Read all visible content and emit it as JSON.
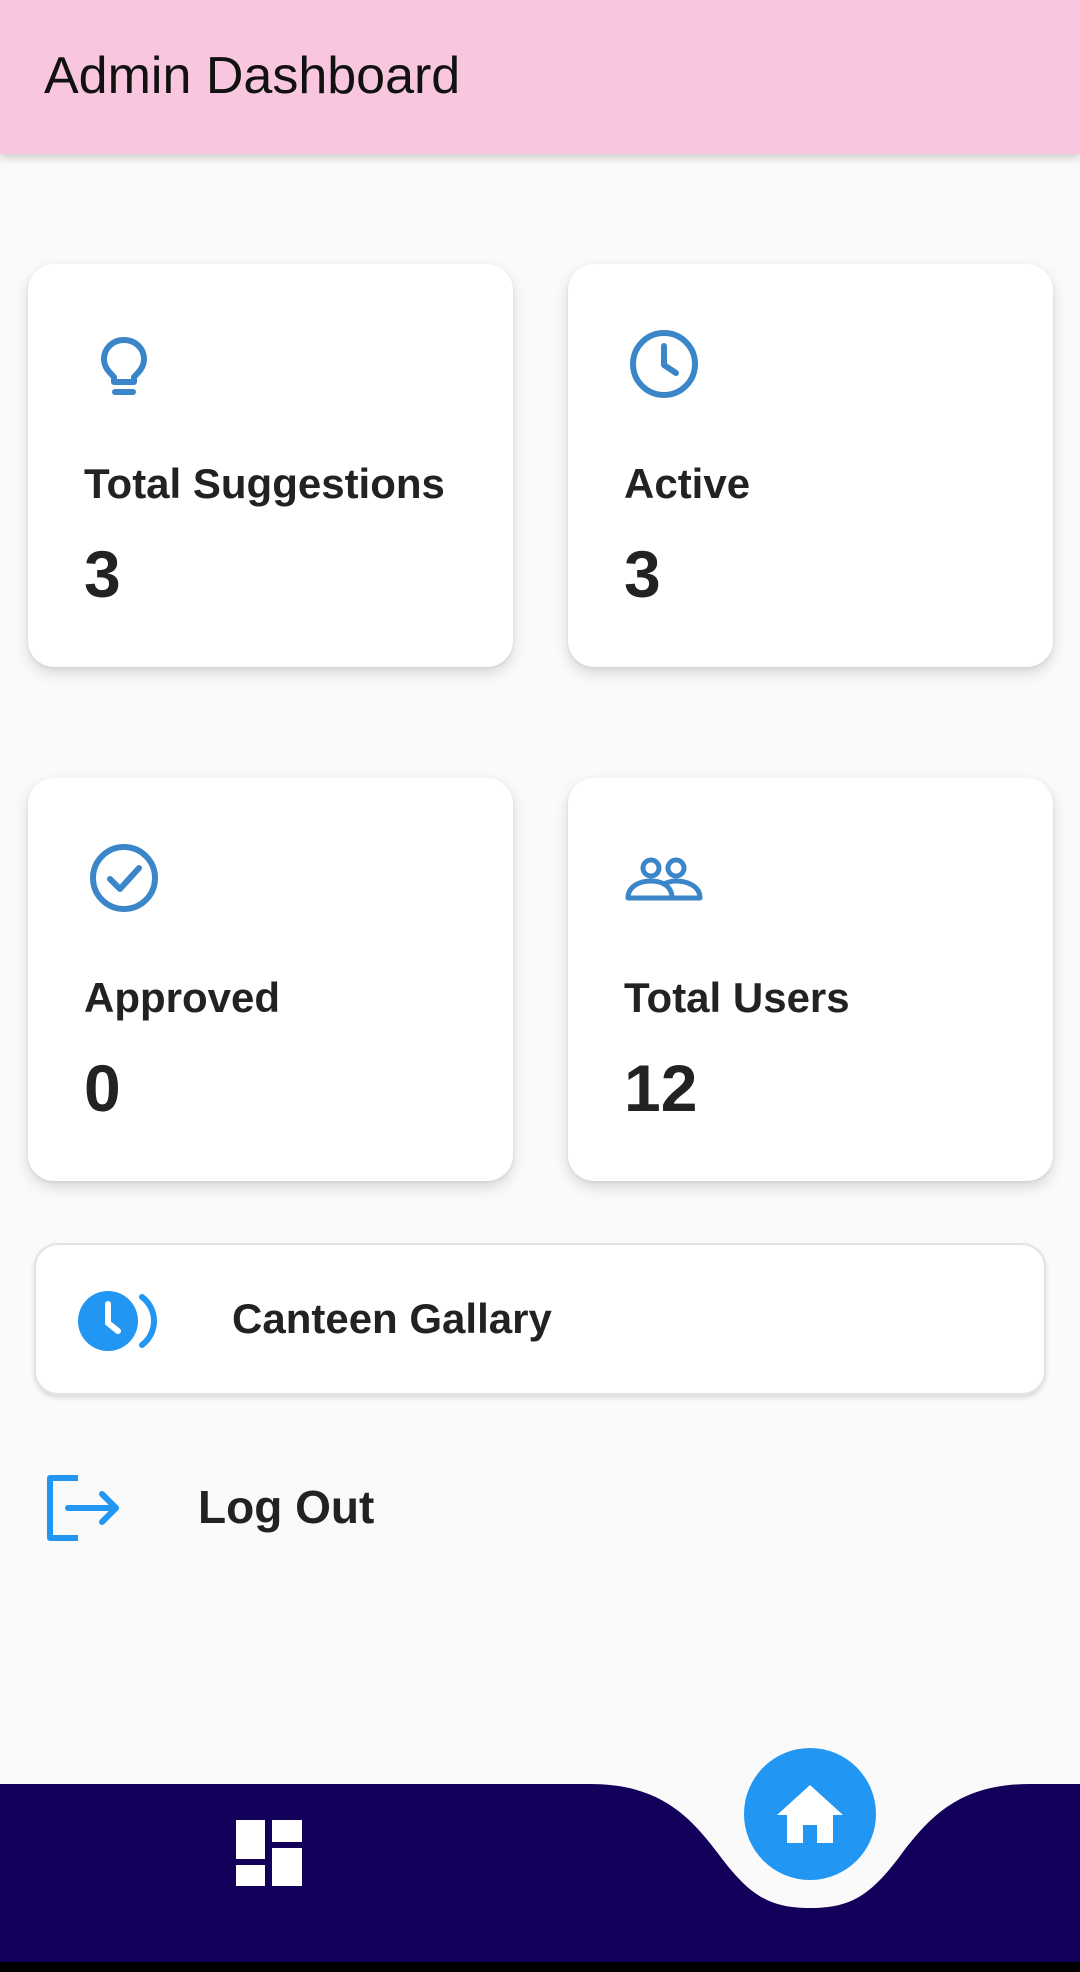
{
  "app_bar": {
    "title": "Admin Dashboard"
  },
  "cards": [
    {
      "icon": "lightbulb-icon",
      "label": "Total Suggestions",
      "value": "3"
    },
    {
      "icon": "clock-icon",
      "label": "Active",
      "value": "3"
    },
    {
      "icon": "check-circle-icon",
      "label": "Approved",
      "value": "0"
    },
    {
      "icon": "users-icon",
      "label": "Total Users",
      "value": "12"
    }
  ],
  "gallery_button": {
    "icon": "history-icon",
    "label": "Canteen Gallary"
  },
  "logout": {
    "icon": "logout-icon",
    "label": "Log Out"
  },
  "bottom_nav": {
    "items": [
      {
        "icon": "dashboard-grid-icon"
      },
      {
        "icon": "home-icon",
        "selected": true
      }
    ],
    "colors": {
      "bar": "#13005a",
      "fab": "#2196f3"
    }
  },
  "colors": {
    "app_bar": "#f8c6de",
    "icon_accent": "#3a86c8"
  }
}
